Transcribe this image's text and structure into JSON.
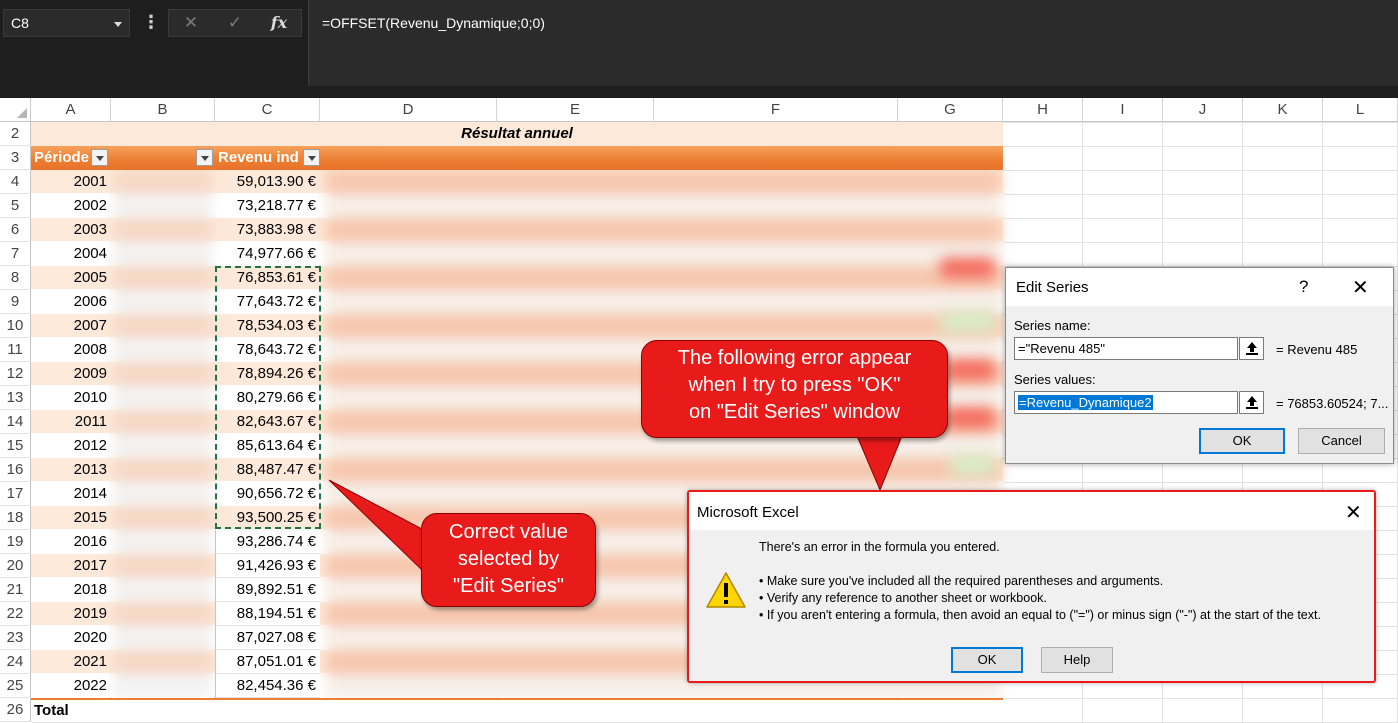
{
  "formula_bar": {
    "name_box": "C8",
    "formula": "=OFFSET(Revenu_Dynamique;0;0)",
    "fx": "fx"
  },
  "columns": [
    "A",
    "B",
    "C",
    "D",
    "E",
    "F",
    "G",
    "H",
    "I",
    "J",
    "K",
    "L"
  ],
  "table": {
    "title": "Résultat annuel",
    "header_periode": "Période",
    "header_revenu": "Revenu ind",
    "total_label": "Total",
    "rows": [
      {
        "row": "4",
        "year": "2001",
        "revenu": "59,013.90 €"
      },
      {
        "row": "5",
        "year": "2002",
        "revenu": "73,218.77 €"
      },
      {
        "row": "6",
        "year": "2003",
        "revenu": "73,883.98 €"
      },
      {
        "row": "7",
        "year": "2004",
        "revenu": "74,977.66 €"
      },
      {
        "row": "8",
        "year": "2005",
        "revenu": "76,853.61 €"
      },
      {
        "row": "9",
        "year": "2006",
        "revenu": "77,643.72 €"
      },
      {
        "row": "10",
        "year": "2007",
        "revenu": "78,534.03 €"
      },
      {
        "row": "11",
        "year": "2008",
        "revenu": "78,643.72 €"
      },
      {
        "row": "12",
        "year": "2009",
        "revenu": "78,894.26 €"
      },
      {
        "row": "13",
        "year": "2010",
        "revenu": "80,279.66 €"
      },
      {
        "row": "14",
        "year": "2011",
        "revenu": "82,643.67 €"
      },
      {
        "row": "15",
        "year": "2012",
        "revenu": "85,613.64 €"
      },
      {
        "row": "16",
        "year": "2013",
        "revenu": "88,487.47 €"
      },
      {
        "row": "17",
        "year": "2014",
        "revenu": "90,656.72 €"
      },
      {
        "row": "18",
        "year": "2015",
        "revenu": "93,500.25 €"
      },
      {
        "row": "19",
        "year": "2016",
        "revenu": "93,286.74 €"
      },
      {
        "row": "20",
        "year": "2017",
        "revenu": "91,426.93 €"
      },
      {
        "row": "21",
        "year": "2018",
        "revenu": "89,892.51 €"
      },
      {
        "row": "22",
        "year": "2019",
        "revenu": "88,194.51 €"
      },
      {
        "row": "23",
        "year": "2020",
        "revenu": "87,027.08 €"
      },
      {
        "row": "24",
        "year": "2021",
        "revenu": "87,051.01 €"
      },
      {
        "row": "25",
        "year": "2022",
        "revenu": "82,454.36 €"
      }
    ],
    "row_labels": [
      "2",
      "3",
      "26"
    ]
  },
  "callouts": {
    "top": [
      "The following error appear",
      "when I try to press \"OK\"",
      "on \"Edit Series\" window"
    ],
    "left": [
      "Correct value",
      "selected by",
      "\"Edit Series\""
    ]
  },
  "edit_series": {
    "title": "Edit Series",
    "help": "?",
    "close": "✕",
    "series_name_label": "Series name:",
    "series_name_value": "=\"Revenu 485\"",
    "series_name_result": "= Revenu 485",
    "series_values_label": "Series values:",
    "series_values_value": "=Revenu_Dynamique2",
    "series_values_result": "= 76853.60524; 7...",
    "ok": "OK",
    "cancel": "Cancel"
  },
  "error_dialog": {
    "title": "Microsoft Excel",
    "close": "✕",
    "message": "There's an error in the formula you entered.",
    "bullets": [
      "• Make sure you've included all the required parentheses and arguments.",
      "• Verify any reference to another sheet or workbook.",
      "• If you aren't entering a formula, then avoid an equal to (\"=\") or minus sign (\"-\") at the start of the text."
    ],
    "ok": "OK",
    "help": "Help"
  }
}
